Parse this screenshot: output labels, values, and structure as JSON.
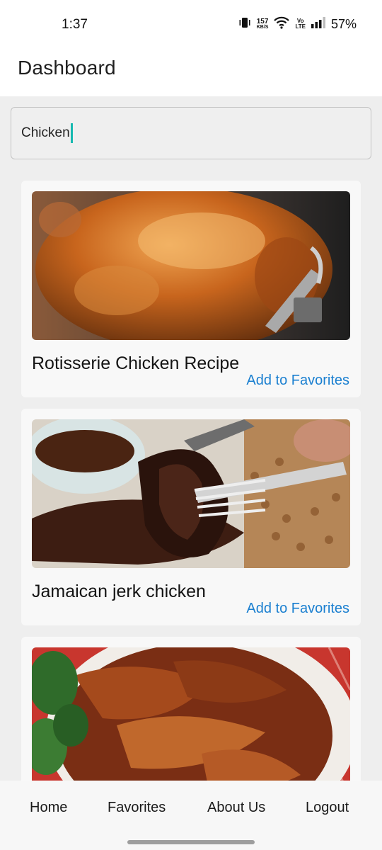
{
  "status_bar": {
    "time": "1:37",
    "net_speed_value": "157",
    "net_speed_unit": "KB/S",
    "volte_top": "Vo",
    "volte_bottom": "LTE",
    "battery": "57%",
    "icons": [
      "vibrate-icon",
      "wifi-icon",
      "signal-icon"
    ]
  },
  "header": {
    "title": "Dashboard"
  },
  "search": {
    "value": "Chicken"
  },
  "recipes": [
    {
      "title": "Rotisserie Chicken Recipe",
      "action": "Add to Favorites"
    },
    {
      "title": "Jamaican jerk chicken",
      "action": "Add to Favorites"
    },
    {
      "title": "",
      "action": ""
    }
  ],
  "nav": {
    "home": "Home",
    "favorites": "Favorites",
    "about": "About Us",
    "logout": "Logout"
  },
  "colors": {
    "link": "#1a7fd0",
    "caret": "#17b9b0"
  }
}
